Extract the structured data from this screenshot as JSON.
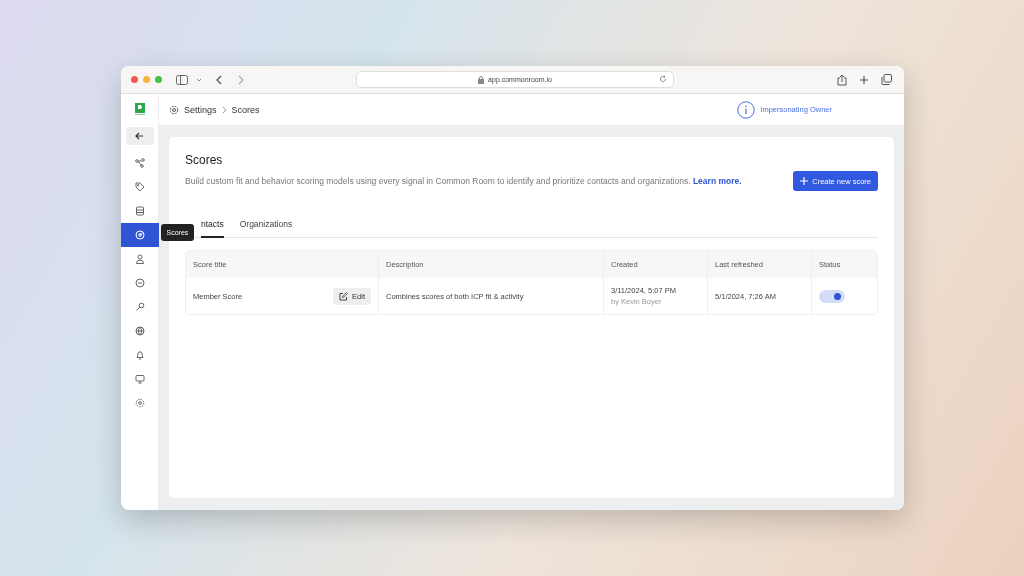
{
  "browser": {
    "url": "app.commonroom.io"
  },
  "breadcrumb": [
    "Settings",
    "Scores"
  ],
  "impersonation": {
    "label": "Impersonating Owner"
  },
  "sidebar": {
    "items": [
      {
        "kind": "nodes",
        "selected": false
      },
      {
        "kind": "tag",
        "selected": false
      },
      {
        "kind": "table",
        "selected": false
      },
      {
        "kind": "score",
        "selected": true,
        "tooltip": "Scores"
      },
      {
        "kind": "person",
        "selected": false
      },
      {
        "kind": "clock",
        "selected": false
      },
      {
        "kind": "key",
        "selected": false
      },
      {
        "kind": "globe",
        "selected": false
      },
      {
        "kind": "bell",
        "selected": false
      },
      {
        "kind": "monitor",
        "selected": false
      },
      {
        "kind": "gear",
        "selected": false
      }
    ]
  },
  "page": {
    "title": "Scores",
    "description": "Build custom fit and behavior scoring models using every signal in Common Room to identify and prioritize contacts and organizations.",
    "link": "Learn more.",
    "create_button": "Create new score"
  },
  "tabs": [
    {
      "label": "ntacts",
      "selected": true
    },
    {
      "label": "Organizations",
      "selected": false
    }
  ],
  "table": {
    "columns": [
      "Score title",
      "Description",
      "Created",
      "Last refreshed",
      "Status"
    ],
    "rows": [
      {
        "title": "Member Score",
        "edit": "Edit",
        "description": "Combines scores of both ICP fit & activity",
        "created": "3/11/2024, 5:07 PM",
        "created_by": "by Kevin Boyer",
        "last_refreshed": "5/1/2024, 7:26 AM",
        "on": true
      }
    ]
  }
}
